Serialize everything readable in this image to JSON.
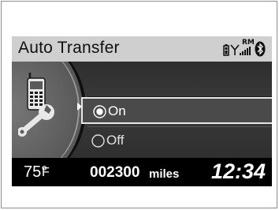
{
  "header": {
    "title": "Auto Transfer",
    "icons": [
      "phone-battery-icon",
      "signal-strength-icon",
      "bluetooth-icon"
    ],
    "roaming_label": "RM"
  },
  "category_icons": [
    "phone-icon",
    "wrench-icon"
  ],
  "options": [
    {
      "label": "On",
      "selected": true
    },
    {
      "label": "Off",
      "selected": false
    }
  ],
  "footer": {
    "temperature": "75°",
    "temperature_unit": "F",
    "odometer": "002300",
    "odometer_unit": "miles",
    "clock": "12:34"
  },
  "colors": {
    "header_bg": "#cfcfcf",
    "screen_bg": "#000000",
    "highlight_border": "#e6e6e6",
    "text": "#ffffff"
  }
}
